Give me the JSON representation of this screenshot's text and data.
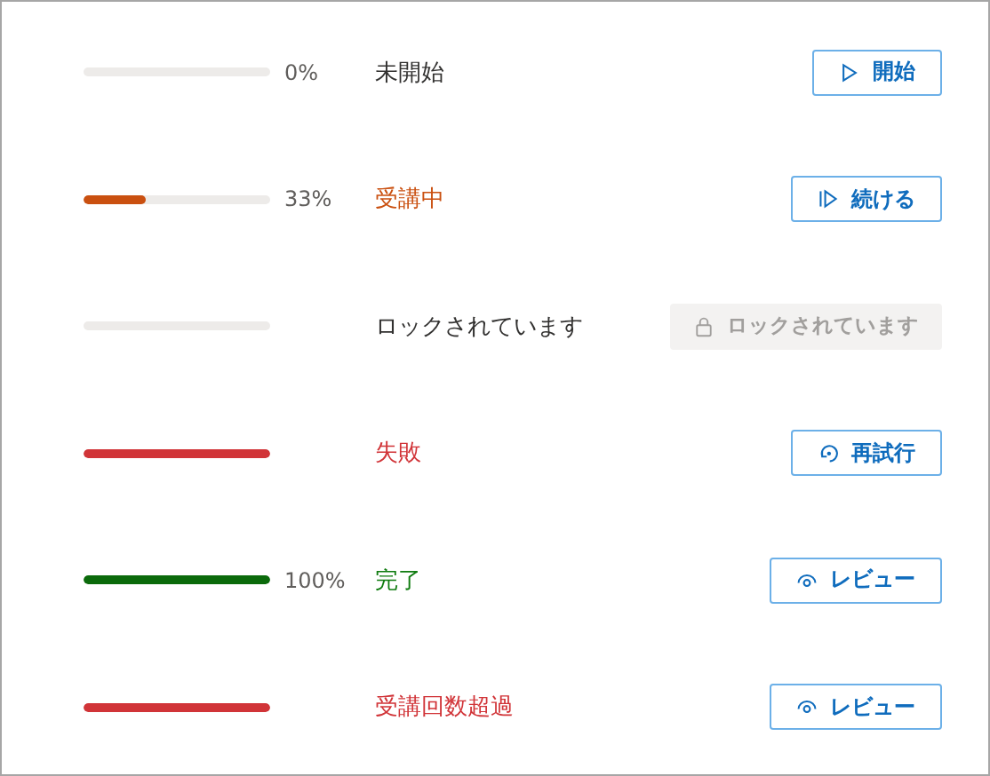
{
  "rows": [
    {
      "kind": "not_started",
      "percent": "0%",
      "label": "未開始",
      "button": {
        "kind": "play",
        "label": "開始",
        "disabled": false
      }
    },
    {
      "kind": "in_progress",
      "level": 0.33,
      "percent": "33%",
      "label": "受講中",
      "button": {
        "kind": "continue",
        "label": "続ける",
        "disabled": false
      }
    },
    {
      "kind": "locked",
      "label": "ロックされています",
      "button": {
        "kind": "lock",
        "label": "ロックされています",
        "disabled": true
      }
    },
    {
      "kind": "failed",
      "level": 1,
      "label": "失敗",
      "button": {
        "kind": "retry",
        "label": "再試行",
        "disabled": false
      }
    },
    {
      "kind": "completed",
      "level": 1,
      "percent": "100%",
      "label": "完了",
      "button": {
        "kind": "review",
        "label": "レビュー",
        "disabled": false
      }
    },
    {
      "kind": "exceeded",
      "level": 1,
      "label": "受講回数超過",
      "button": {
        "kind": "review",
        "label": "レビュー",
        "disabled": false
      }
    }
  ]
}
